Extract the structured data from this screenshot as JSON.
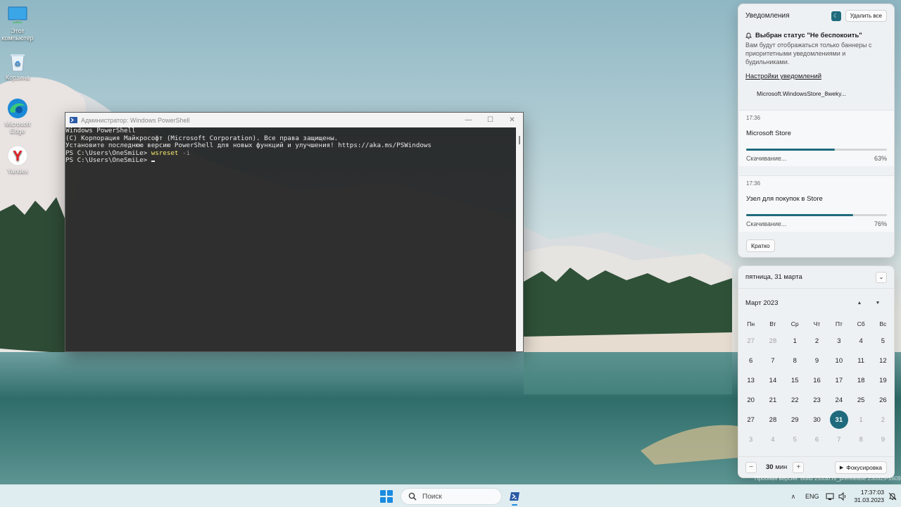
{
  "desktop": {
    "icons": [
      {
        "label": "Этот компьютер",
        "icon": "monitor-icon"
      },
      {
        "label": "Корзина",
        "icon": "recycle-bin-icon"
      },
      {
        "label": "Microsoft Edge",
        "icon": "edge-icon"
      },
      {
        "label": "Yandex",
        "icon": "yandex-browser-icon"
      }
    ]
  },
  "powershell": {
    "title": "Администратор: Windows PowerShell",
    "lines": [
      "Windows PowerShell",
      "(C) Корпорация Майкрософт (Microsoft Corporation). Все права защищены.",
      "",
      "Установите последнюю версию PowerShell для новых функций и улучшения! https://aka.ms/PSWindows",
      ""
    ],
    "prompt": "PS C:\\Users\\OneSmiLe> ",
    "command": "wsreset",
    "command_param": " -i",
    "prompt2": "PS C:\\Users\\OneSmiLe> "
  },
  "notifications": {
    "header": "Уведомления",
    "clear_all": "Удалить все",
    "dnd_title": "Выбран статус \"Не беспокоить\"",
    "dnd_desc": "Вам будут отображаться только баннеры с приоритетными уведомлениями и будильниками.",
    "settings_link": "Настройки уведомлений",
    "app_group": "Microsoft.WindowsStore_8weky...",
    "toasts": [
      {
        "time": "17:36",
        "app": "Microsoft Store",
        "status": "Скачивание...",
        "percent_label": "63%",
        "progress": 0.63
      },
      {
        "time": "17:36",
        "app": "Узел для покупок в Store",
        "status": "Скачивание...",
        "percent_label": "76%",
        "progress": 0.76
      }
    ],
    "brief_button": "Кратко"
  },
  "calendar": {
    "date_header": "пятница, 31 марта",
    "month": "Март 2023",
    "weekdays": [
      "Пн",
      "Вт",
      "Ср",
      "Чт",
      "Пт",
      "Сб",
      "Вс"
    ],
    "days": [
      {
        "d": "27",
        "other": true
      },
      {
        "d": "28",
        "other": true
      },
      {
        "d": "1"
      },
      {
        "d": "2"
      },
      {
        "d": "3"
      },
      {
        "d": "4"
      },
      {
        "d": "5"
      },
      {
        "d": "6"
      },
      {
        "d": "7"
      },
      {
        "d": "8"
      },
      {
        "d": "9"
      },
      {
        "d": "10"
      },
      {
        "d": "11"
      },
      {
        "d": "12"
      },
      {
        "d": "13"
      },
      {
        "d": "14"
      },
      {
        "d": "15"
      },
      {
        "d": "16"
      },
      {
        "d": "17"
      },
      {
        "d": "18"
      },
      {
        "d": "19"
      },
      {
        "d": "20"
      },
      {
        "d": "21"
      },
      {
        "d": "22"
      },
      {
        "d": "23"
      },
      {
        "d": "24"
      },
      {
        "d": "25"
      },
      {
        "d": "26"
      },
      {
        "d": "27"
      },
      {
        "d": "28"
      },
      {
        "d": "29"
      },
      {
        "d": "30"
      },
      {
        "d": "31",
        "today": true
      },
      {
        "d": "1",
        "other": true
      },
      {
        "d": "2",
        "other": true
      },
      {
        "d": "3",
        "other": true
      },
      {
        "d": "4",
        "other": true
      },
      {
        "d": "5",
        "other": true
      },
      {
        "d": "6",
        "other": true
      },
      {
        "d": "7",
        "other": true
      },
      {
        "d": "8",
        "other": true
      },
      {
        "d": "9",
        "other": true
      }
    ],
    "focus_minutes": "30",
    "focus_unit": "мин",
    "focus_button": "Фокусировка"
  },
  "watermark": "Пробная версия. Build 25330.rs_prerelease.230325-1609",
  "taskbar": {
    "search_placeholder": "Поиск",
    "lang": "ENG",
    "time": "17:37:03",
    "date": "31.03.2023"
  },
  "colors": {
    "accent": "#1f6b7d",
    "start": "#1a8be0"
  }
}
